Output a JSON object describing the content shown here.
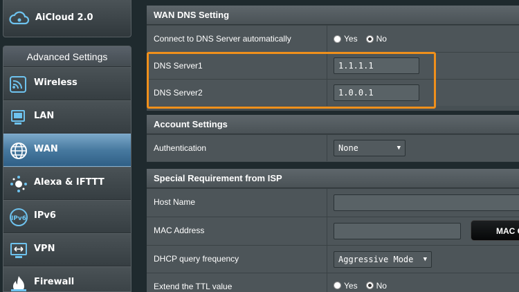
{
  "sidebar": {
    "aicloud_label": "AiCloud 2.0",
    "advanced_header": "Advanced Settings",
    "items": [
      {
        "label": "Wireless",
        "icon": "wireless-icon"
      },
      {
        "label": "LAN",
        "icon": "lan-icon"
      },
      {
        "label": "WAN",
        "icon": "globe-icon",
        "active": true
      },
      {
        "label": "Alexa & IFTTT",
        "icon": "alexa-icon"
      },
      {
        "label": "IPv6",
        "icon": "ipv6-icon"
      },
      {
        "label": "VPN",
        "icon": "vpn-icon"
      },
      {
        "label": "Firewall",
        "icon": "firewall-icon"
      }
    ]
  },
  "wan_dns": {
    "title": "WAN DNS Setting",
    "auto_label": "Connect to DNS Server automatically",
    "auto_yes": "Yes",
    "auto_no": "No",
    "auto_selected": "No",
    "dns1_label": "DNS Server1",
    "dns1_value": "1.1.1.1",
    "dns2_label": "DNS Server2",
    "dns2_value": "1.0.0.1"
  },
  "account": {
    "title": "Account Settings",
    "auth_label": "Authentication",
    "auth_value": "None"
  },
  "isp": {
    "title": "Special Requirement from ISP",
    "host_label": "Host Name",
    "host_value": "",
    "mac_label": "MAC Address",
    "mac_value": "",
    "mac_button": "MAC C",
    "dhcp_label": "DHCP query frequency",
    "dhcp_value": "Aggressive Mode",
    "ttl_label": "Extend the TTL value",
    "ttl_yes": "Yes",
    "ttl_no": "No",
    "ttl_selected": "No"
  },
  "colors": {
    "highlight": "#f0901b",
    "active_nav": "#47799f"
  }
}
